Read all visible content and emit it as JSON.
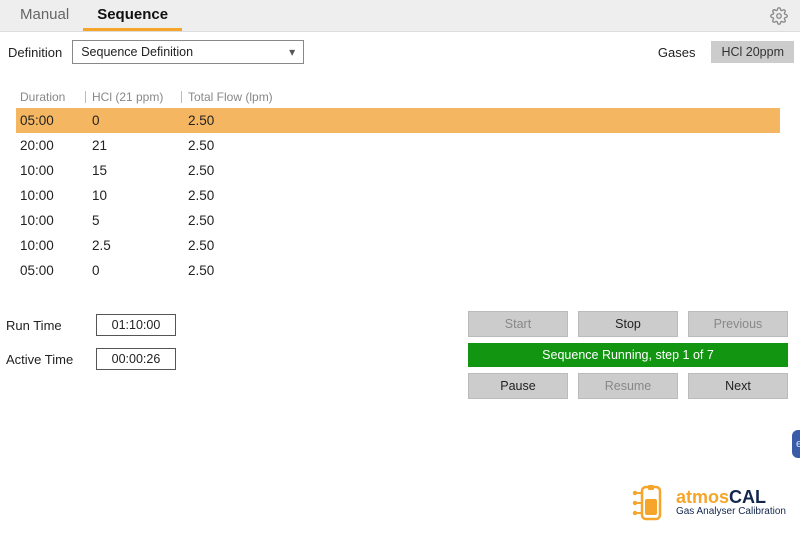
{
  "tabs": {
    "manual": "Manual",
    "sequence": "Sequence"
  },
  "definition": {
    "label": "Definition",
    "value": "Sequence Definition"
  },
  "gases": {
    "label": "Gases",
    "chip": "HCl 20ppm"
  },
  "table": {
    "headers": {
      "duration": "Duration",
      "hcl": "HCl (21 ppm)",
      "flow": "Total Flow (lpm)"
    },
    "rows": [
      {
        "duration": "05:00",
        "hcl": "0",
        "flow": "2.50",
        "selected": true
      },
      {
        "duration": "20:00",
        "hcl": "21",
        "flow": "2.50",
        "selected": false
      },
      {
        "duration": "10:00",
        "hcl": "15",
        "flow": "2.50",
        "selected": false
      },
      {
        "duration": "10:00",
        "hcl": "10",
        "flow": "2.50",
        "selected": false
      },
      {
        "duration": "10:00",
        "hcl": "5",
        "flow": "2.50",
        "selected": false
      },
      {
        "duration": "10:00",
        "hcl": "2.5",
        "flow": "2.50",
        "selected": false
      },
      {
        "duration": "05:00",
        "hcl": "0",
        "flow": "2.50",
        "selected": false
      }
    ]
  },
  "timers": {
    "run_label": "Run Time",
    "run_value": "01:10:00",
    "active_label": "Active Time",
    "active_value": "00:00:26"
  },
  "buttons": {
    "start": "Start",
    "stop": "Stop",
    "previous": "Previous",
    "pause": "Pause",
    "resume": "Resume",
    "next": "Next"
  },
  "status": "Sequence Running, step 1 of 7",
  "logo": {
    "brand_a": "atmos",
    "brand_b": "CAL",
    "sub": "Gas Analyser Calibration"
  }
}
